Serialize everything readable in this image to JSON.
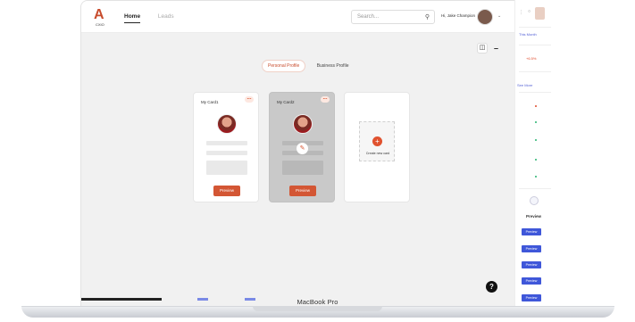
{
  "brand": {
    "logo_text": "A",
    "logo_sub": "CXIO"
  },
  "nav": {
    "home": "Home",
    "leads": "Leads"
  },
  "search": {
    "placeholder": "Search..."
  },
  "user": {
    "name": "Hi, Jake Champion"
  },
  "tabs": {
    "personal": "Personal Profile",
    "business": "Business Profile"
  },
  "cards": [
    {
      "title": "My Card1",
      "button": "Preview"
    },
    {
      "title": "My Card2",
      "button": "Preview"
    }
  ],
  "add_card": {
    "label": "Create new card"
  },
  "help": "?",
  "right_panel": {
    "this_month": "This Month",
    "percent": "+6.5%",
    "see_more": "See More",
    "preview_title": "Preview",
    "preview_buttons": [
      "Preview",
      "Preview",
      "Preview",
      "Preview",
      "Preview"
    ]
  },
  "device": {
    "label": "MacBook Pro"
  },
  "colors": {
    "accent": "#d35634",
    "blue": "#3f57d9"
  }
}
